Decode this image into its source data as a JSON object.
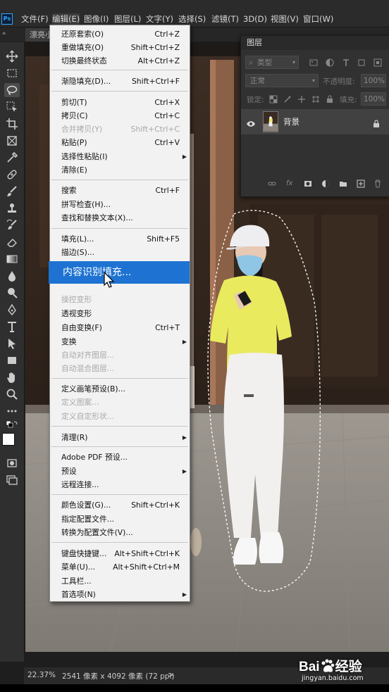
{
  "menubar": {
    "logo": "Ps",
    "items": [
      "文件(F)",
      "编辑(E)",
      "图像(I)",
      "图层(L)",
      "文字(Y)",
      "选择(S)",
      "滤镜(T)",
      "3D(D)",
      "视图(V)",
      "窗口(W)"
    ]
  },
  "document": {
    "tab_label": "漂亮小"
  },
  "edit_menu": {
    "items": [
      {
        "label": "还原套索(O)",
        "shortcut": "Ctrl+Z"
      },
      {
        "label": "重做填充(O)",
        "shortcut": "Shift+Ctrl+Z"
      },
      {
        "label": "切换最终状态",
        "shortcut": "Alt+Ctrl+Z"
      },
      {
        "label": "渐隐填充(D)...",
        "shortcut": "Shift+Ctrl+F"
      },
      {
        "label": "剪切(T)",
        "shortcut": "Ctrl+X"
      },
      {
        "label": "拷贝(C)",
        "shortcut": "Ctrl+C"
      },
      {
        "label": "合并拷贝(Y)",
        "shortcut": "Shift+Ctrl+C"
      },
      {
        "label": "粘贴(P)",
        "shortcut": "Ctrl+V"
      },
      {
        "label": "选择性粘贴(I)",
        "shortcut": ""
      },
      {
        "label": "清除(E)",
        "shortcut": ""
      },
      {
        "label": "搜索",
        "shortcut": "Ctrl+F"
      },
      {
        "label": "拼写检查(H)...",
        "shortcut": ""
      },
      {
        "label": "查找和替换文本(X)...",
        "shortcut": ""
      },
      {
        "label": "填充(L)...",
        "shortcut": "Shift+F5"
      },
      {
        "label": "描边(S)...",
        "shortcut": ""
      },
      {
        "label": "内容识别填充...",
        "shortcut": ""
      },
      {
        "label": "操控变形",
        "shortcut": ""
      },
      {
        "label": "透视变形",
        "shortcut": ""
      },
      {
        "label": "自由变换(F)",
        "shortcut": "Ctrl+T"
      },
      {
        "label": "变换",
        "shortcut": ""
      },
      {
        "label": "自动对齐图层...",
        "shortcut": ""
      },
      {
        "label": "自动混合图层...",
        "shortcut": ""
      },
      {
        "label": "定义画笔预设(B)...",
        "shortcut": ""
      },
      {
        "label": "定义图案...",
        "shortcut": ""
      },
      {
        "label": "定义自定形状...",
        "shortcut": ""
      },
      {
        "label": "清理(R)",
        "shortcut": ""
      },
      {
        "label": "Adobe PDF 预设...",
        "shortcut": ""
      },
      {
        "label": "预设",
        "shortcut": ""
      },
      {
        "label": "远程连接...",
        "shortcut": ""
      },
      {
        "label": "颜色设置(G)...",
        "shortcut": "Shift+Ctrl+K"
      },
      {
        "label": "指定配置文件...",
        "shortcut": ""
      },
      {
        "label": "转换为配置文件(V)...",
        "shortcut": ""
      },
      {
        "label": "键盘快捷键...",
        "shortcut": "Alt+Shift+Ctrl+K"
      },
      {
        "label": "菜单(U)...",
        "shortcut": "Alt+Shift+Ctrl+M"
      },
      {
        "label": "工具栏...",
        "shortcut": ""
      },
      {
        "label": "首选项(N)",
        "shortcut": ""
      }
    ]
  },
  "layers_panel": {
    "title": "图层",
    "filter_placeholder": "类型",
    "blend_mode": "正常",
    "opacity_label": "不透明度:",
    "opacity_value": "100%",
    "lock_label": "锁定:",
    "fill_label": "填充:",
    "fill_value": "100%",
    "layer_name": "背景"
  },
  "statusbar": {
    "zoom": "22.37%",
    "dimensions": "2541 像素 x 4092 像素 (72 ppi)",
    "arrow": ">"
  },
  "watermark": {
    "brand": "Bai",
    "brand2": "经验",
    "url": "jingyan.baidu.com"
  }
}
